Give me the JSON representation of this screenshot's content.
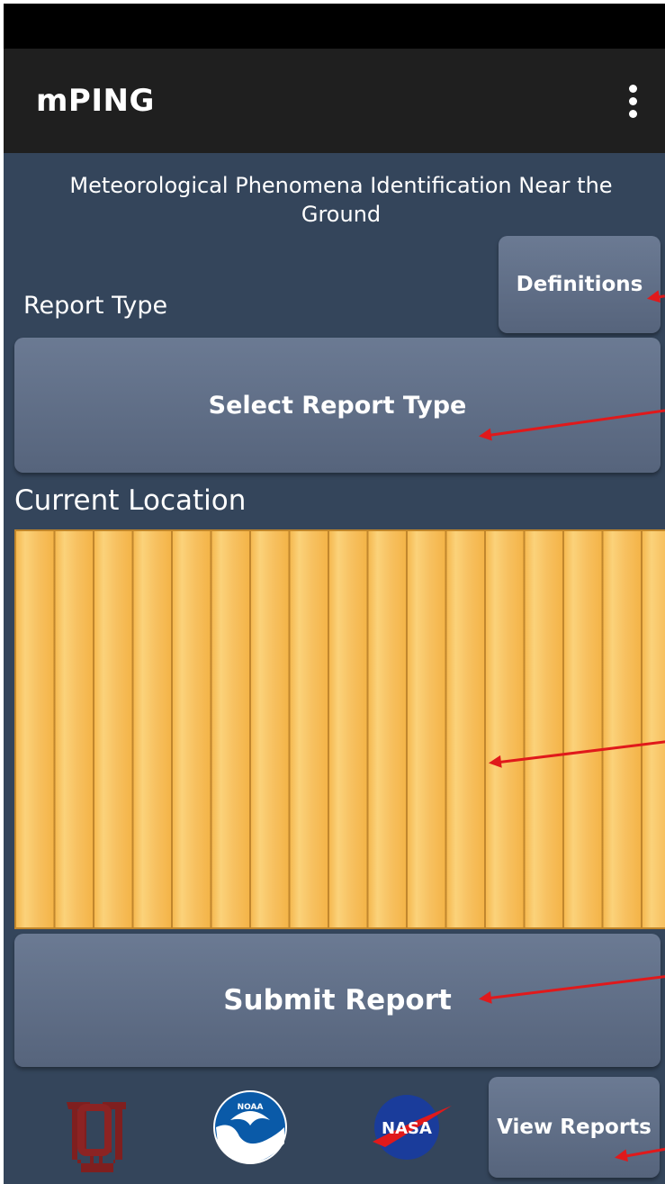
{
  "app": {
    "title": "mPING",
    "subtitle": "Meteorological Phenomena Identification Near the Ground"
  },
  "report_type": {
    "label": "Report Type",
    "definitions_button": "Definitions",
    "select_button": "Select Report Type"
  },
  "location": {
    "label": "Current Location"
  },
  "actions": {
    "submit_button": "Submit Report",
    "view_reports_button": "View Reports"
  },
  "logos": {
    "ou": "OU",
    "noaa": "NOAA",
    "nasa": "NASA"
  },
  "colors": {
    "background": "#34455b",
    "app_bar": "#1f1f1f",
    "button": "#5f6e87",
    "annotation_arrow": "#e0191b"
  },
  "icons": {
    "overflow_menu": "more-vert-icon",
    "annotation": "red-arrow-icon"
  }
}
